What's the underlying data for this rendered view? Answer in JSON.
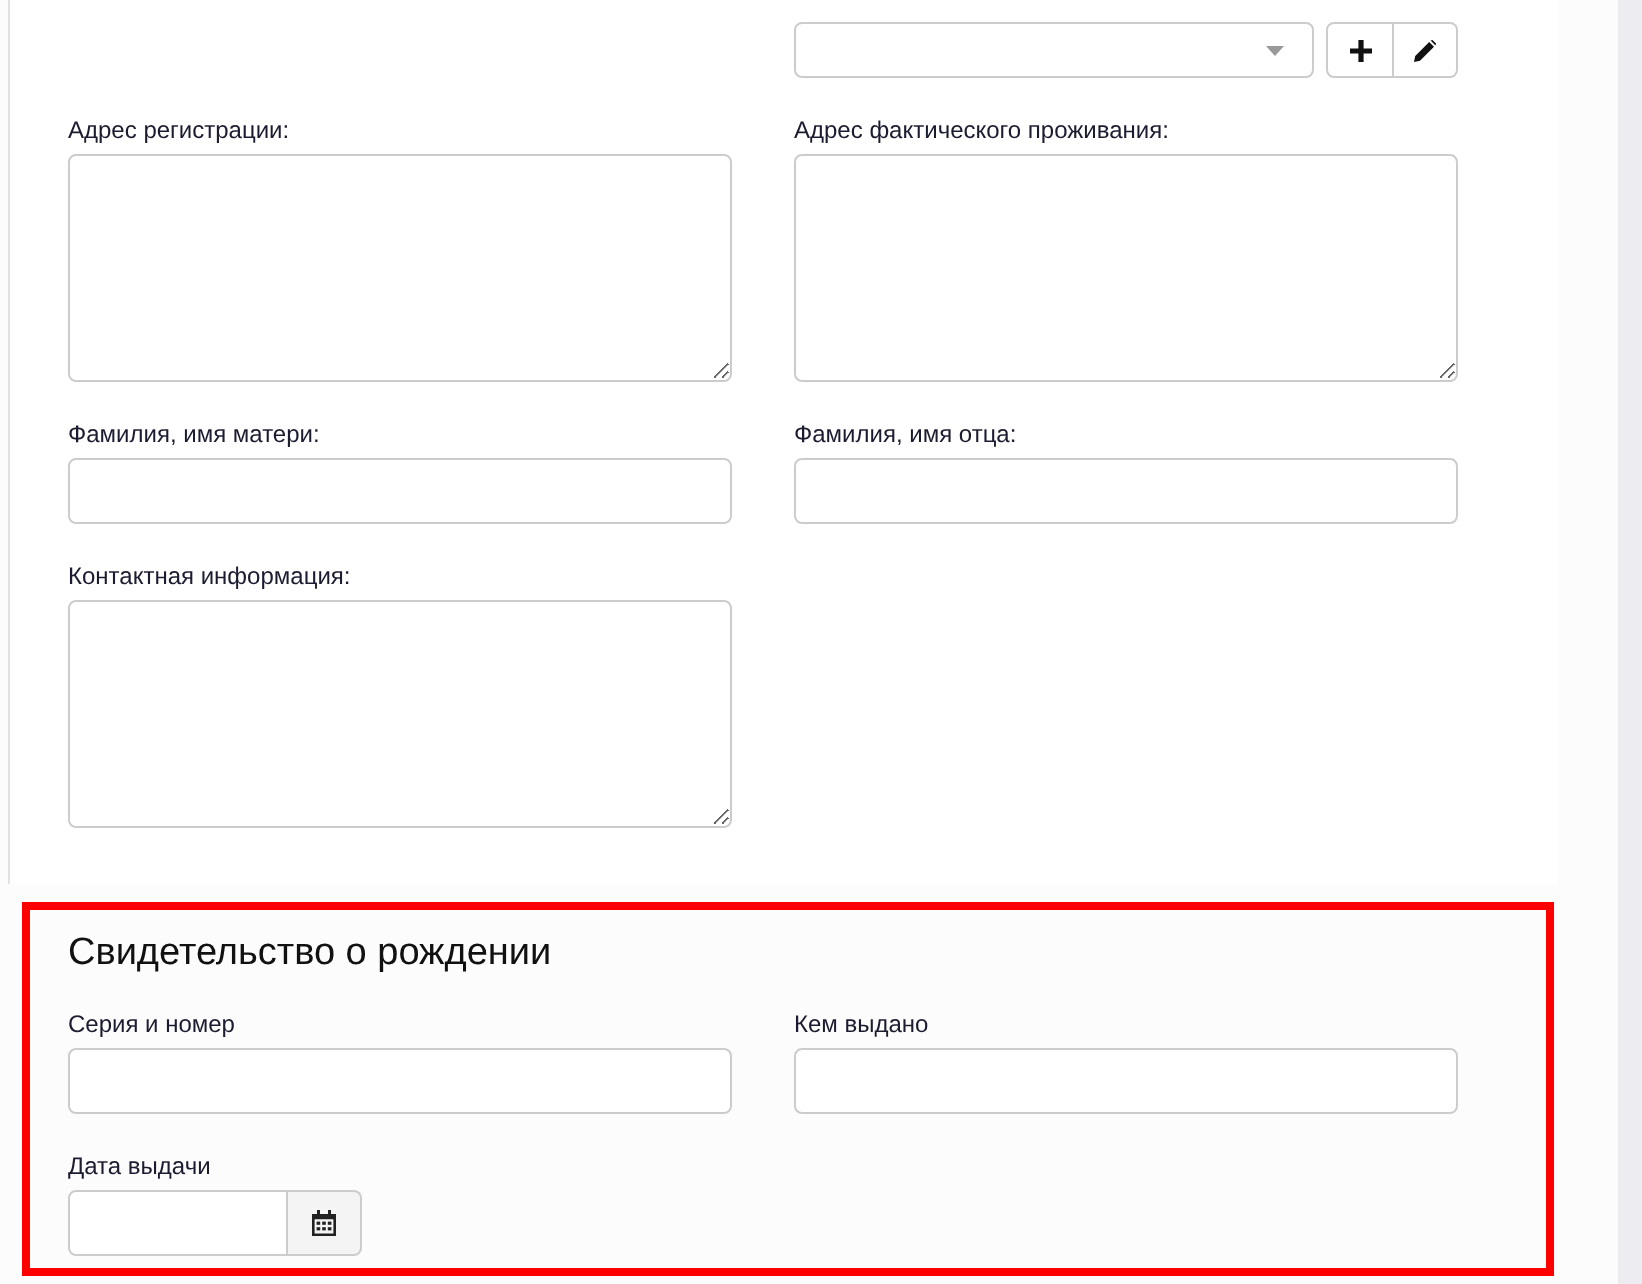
{
  "form": {
    "rows": [
      {
        "right": {
          "kind": "select",
          "actions": [
            {
              "kind": "add"
            },
            {
              "kind": "edit"
            }
          ]
        }
      },
      {
        "left": {
          "kind": "textarea",
          "label": "Адрес регистрации:"
        },
        "right": {
          "kind": "textarea",
          "label": "Адрес фактического проживания:"
        }
      },
      {
        "left": {
          "kind": "text",
          "label": "Фамилия, имя матери:"
        },
        "right": {
          "kind": "text",
          "label": "Фамилия, имя отца:"
        }
      },
      {
        "left": {
          "kind": "textarea",
          "label": "Контактная информация:"
        }
      }
    ]
  },
  "birth_certificate": {
    "title": "Свидетельство о рождении",
    "rows": [
      {
        "left": {
          "kind": "text",
          "label": "Серия и номер"
        },
        "right": {
          "kind": "text",
          "label": "Кем выдано"
        }
      },
      {
        "left": {
          "kind": "date",
          "label": "Дата выдачи"
        }
      }
    ]
  }
}
